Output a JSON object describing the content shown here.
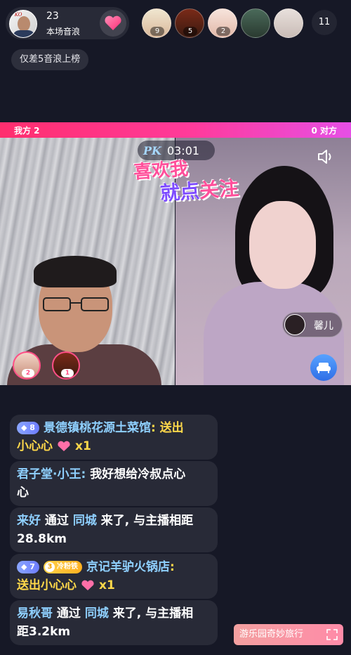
{
  "host": {
    "count": "23",
    "label": "本场音浪",
    "avatar_text": "PKO"
  },
  "viewers": [
    {
      "badge": "9",
      "icon": "viewer-avatar-icon"
    },
    {
      "badge": "5",
      "icon": "viewer-avatar-icon"
    },
    {
      "badge": "2",
      "icon": "viewer-avatar-icon"
    },
    {
      "badge": "",
      "icon": "viewer-avatar-icon"
    },
    {
      "badge": "",
      "icon": "viewer-avatar-icon"
    }
  ],
  "viewer_count": "11",
  "rank_hint": "仅差5音浪上榜",
  "pk": {
    "left_label": "我方 2",
    "right_label": "0 对方",
    "logo": "PK",
    "timer": "03:01"
  },
  "stickers": {
    "line1": "喜欢我",
    "line2_a": "就点",
    "line2_b": "关注"
  },
  "guest": {
    "name": "馨儿"
  },
  "rank_avatars": [
    {
      "badge": "2"
    },
    {
      "badge": "1"
    }
  ],
  "chat": [
    {
      "level": "8",
      "name": "景德镇桃花源土菜馆",
      "sep": ":",
      "action": "送出",
      "gift": "小心心",
      "multiplier": "x1"
    },
    {
      "name": "君子堂·小王",
      "sep": ":",
      "text": "我好想给冷叔点心",
      "text2": "心"
    },
    {
      "name": "来好",
      "text_a": "通过",
      "via": "同城",
      "text_b": "来了, 与主播相距",
      "text2": "28.8km"
    },
    {
      "level": "7",
      "fan_level": "3",
      "fan_label": "冷粉铁",
      "name": "京记羊驴火锅店",
      "sep": ":",
      "action": "送出",
      "gift": "小心心",
      "multiplier": "x1"
    },
    {
      "name": "易秋哥",
      "text_a": "通过",
      "via": "同城",
      "text_b": "来了, 与主播相",
      "text2": "距3.2km"
    }
  ],
  "game_pill": {
    "label": "游乐园奇妙旅行"
  },
  "colors": {
    "background": "#161826",
    "pk_bar_start": "#ff2e6e",
    "pk_bar_end": "#e64fe6",
    "name_blue": "#8fd0ff",
    "gift_yellow": "#ffd84a"
  }
}
